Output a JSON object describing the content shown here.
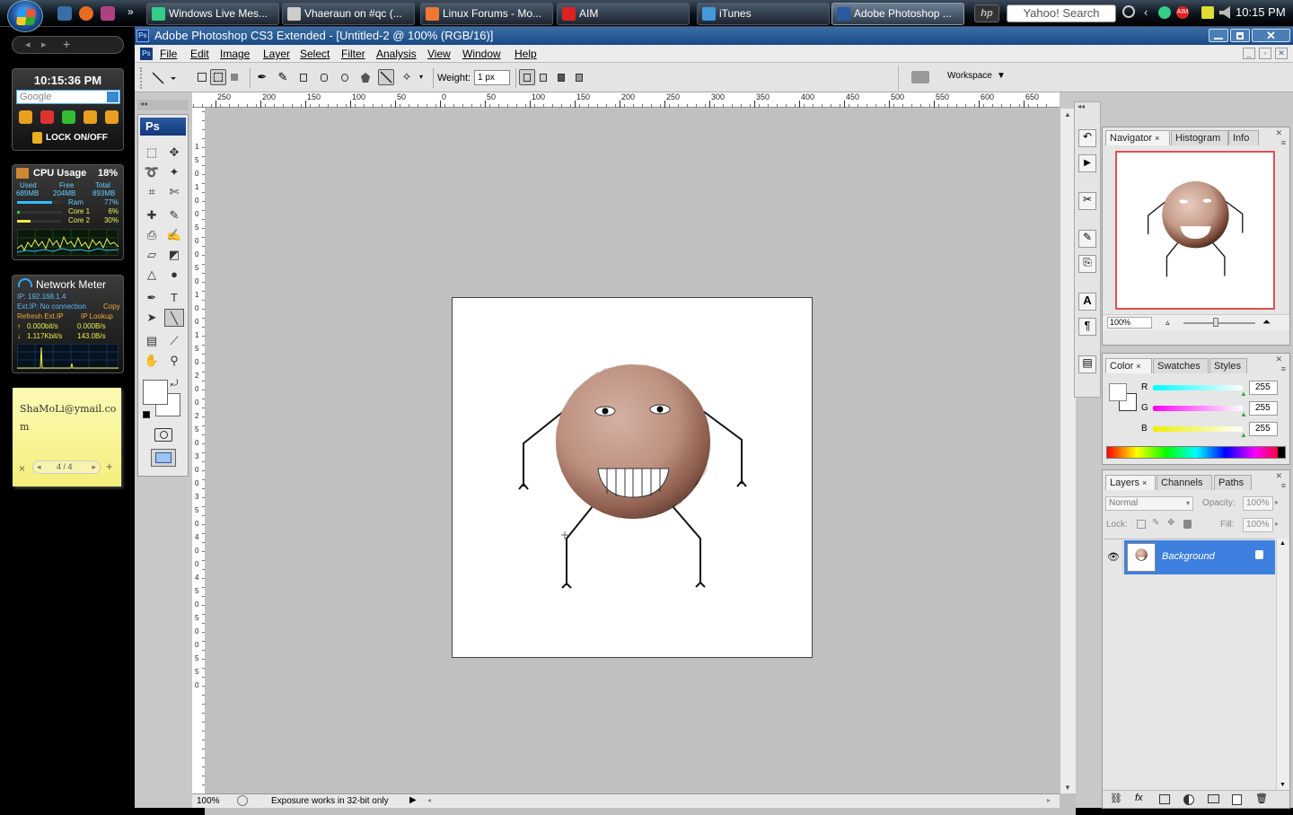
{
  "taskbar": {
    "tasks": [
      {
        "label": "Windows Live Mes...",
        "icon": "messenger-icon",
        "color": "#3c8"
      },
      {
        "label": "Vhaeraun on #qc (...",
        "icon": "xchat-icon",
        "color": "#ccc"
      },
      {
        "label": "Linux Forums - Mo...",
        "icon": "firefox-icon",
        "color": "#e73"
      },
      {
        "label": "AIM",
        "icon": "aim-icon",
        "color": "#d22"
      },
      {
        "label": "iTunes",
        "icon": "itunes-icon",
        "color": "#49d"
      },
      {
        "label": "Adobe Photoshop ...",
        "icon": "photoshop-icon",
        "color": "#2a5aa0"
      }
    ],
    "search_label": "Yahoo! Search",
    "hp_label": "hp",
    "clock": "10:15 PM"
  },
  "sidebar": {
    "clock_time": "10:15:36 PM",
    "google_placeholder": "Google",
    "lock_label": "LOCK ON/OFF",
    "cpu": {
      "title": "CPU Usage",
      "percent": "18%",
      "used_h": "Used",
      "free_h": "Free",
      "total_h": "Total",
      "used": "689MB",
      "free": "204MB",
      "total": "893MB",
      "ram_label": "Ram",
      "ram": "77%",
      "ram_level": 0.77,
      "core1_label": "Core 1",
      "core1": "6%",
      "core1_level": 0.06,
      "core2_label": "Core 2",
      "core2": "30%",
      "core2_level": 0.3
    },
    "net": {
      "title": "Network Meter",
      "ip": "IP: 192.168.1.4",
      "extip": "Ext.IP: No connection",
      "copy": "Copy",
      "refresh": "Refresh Ext.IP",
      "lookup": "IP Lookup",
      "up_rate": "0.000bit/s",
      "up_bytes": "0.000B/s",
      "down_rate": "1.117Kbit/s",
      "down_bytes": "143.0B/s"
    },
    "note": {
      "text": "ShaMoLi@ymail.com",
      "page": "4 / 4",
      "close": "×",
      "add": "+"
    }
  },
  "photoshop": {
    "title": "Adobe Photoshop CS3 Extended - [Untitled-2 @ 100% (RGB/16)]",
    "menu": [
      "File",
      "Edit",
      "Image",
      "Layer",
      "Select",
      "Filter",
      "Analysis",
      "View",
      "Window",
      "Help"
    ],
    "options": {
      "weight_label": "Weight:",
      "weight_value": "1 px",
      "workspace": "Workspace"
    },
    "ruler_top": [
      "250",
      "200",
      "150",
      "100",
      "50",
      "0",
      "50",
      "100",
      "150",
      "200",
      "250",
      "300",
      "350",
      "400",
      "450",
      "500",
      "550",
      "600",
      "650"
    ],
    "ruler_left": [
      "1",
      "5",
      "0",
      "1",
      "0",
      "0",
      "5",
      "0",
      "0",
      "5",
      "0",
      "1",
      "0",
      "0",
      "1",
      "5",
      "0",
      "2",
      "0",
      "0",
      "2",
      "5",
      "0",
      "3",
      "0",
      "0",
      "3",
      "5",
      "0",
      "4",
      "0",
      "0",
      "4",
      "5",
      "0",
      "5",
      "0",
      "0",
      "5",
      "5",
      "0"
    ],
    "status": {
      "zoom": "100%",
      "message": "Exposure works in 32-bit only"
    },
    "ps_logo": "Ps",
    "navigator": {
      "tabs": [
        "Navigator",
        "Histogram",
        "Info"
      ],
      "zoom": "100%"
    },
    "color": {
      "tabs": [
        "Color",
        "Swatches",
        "Styles"
      ],
      "r_label": "R",
      "g_label": "G",
      "b_label": "B",
      "r": "255",
      "g": "255",
      "b": "255"
    },
    "layers": {
      "tabs": [
        "Layers",
        "Channels",
        "Paths"
      ],
      "blend": "Normal",
      "opacity_label": "Opacity:",
      "opacity": "100%",
      "lock_label": "Lock:",
      "fill_label": "Fill:",
      "fill": "100%",
      "layer_name": "Background"
    }
  }
}
